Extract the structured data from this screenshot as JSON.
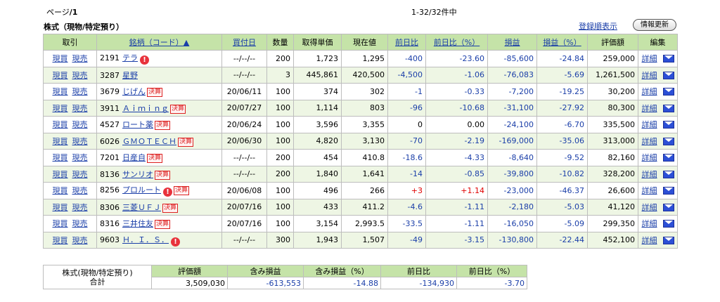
{
  "header": {
    "page_prefix": "ページ",
    "page_num": "/1",
    "count": "1-32/32件中",
    "title": "株式（現物/特定預り）",
    "sort_link": "登録順表示",
    "refresh_label": "情報更新"
  },
  "columns": {
    "trade": "取引",
    "name": "銘柄（コード）▲",
    "buy_date": "買付日",
    "qty": "数量",
    "cost": "取得単価",
    "price": "現在値",
    "change": "前日比",
    "change_pct": "前日比（%）",
    "pl": "損益",
    "pl_pct": "損益（%）",
    "value": "評価額",
    "edit": "編集"
  },
  "labels": {
    "buy": "現買",
    "sell": "現売",
    "detail": "詳細",
    "alert_icon": "!",
    "kessan": "決算"
  },
  "rows": [
    {
      "code": "2191",
      "name": "テラ",
      "alert": true,
      "kessan": false,
      "date": "--/--/--",
      "qty": "200",
      "cost": "1,723",
      "price": "1,295",
      "chg": "-400",
      "chg_pct": "-23.60",
      "pl": "-85,600",
      "pl_pct": "-24.84",
      "value": "259,000"
    },
    {
      "code": "3287",
      "name": "星野",
      "alert": false,
      "kessan": false,
      "date": "--/--/--",
      "qty": "3",
      "cost": "445,861",
      "price": "420,500",
      "chg": "-4,500",
      "chg_pct": "-1.06",
      "pl": "-76,083",
      "pl_pct": "-5.69",
      "value": "1,261,500"
    },
    {
      "code": "3679",
      "name": "じげん",
      "alert": false,
      "kessan": true,
      "date": "20/06/11",
      "qty": "100",
      "cost": "374",
      "price": "302",
      "chg": "-1",
      "chg_pct": "-0.33",
      "pl": "-7,200",
      "pl_pct": "-19.25",
      "value": "30,200"
    },
    {
      "code": "3911",
      "name": "Ａｉｍｉｎｇ",
      "alert": false,
      "kessan": true,
      "date": "20/07/27",
      "qty": "100",
      "cost": "1,114",
      "price": "803",
      "chg": "-96",
      "chg_pct": "-10.68",
      "pl": "-31,100",
      "pl_pct": "-27.92",
      "value": "80,300"
    },
    {
      "code": "4527",
      "name": "ロート薬",
      "alert": false,
      "kessan": true,
      "date": "20/06/24",
      "qty": "100",
      "cost": "3,596",
      "price": "3,355",
      "chg": "0",
      "chg_pct": "0.00",
      "pl": "-24,100",
      "pl_pct": "-6.70",
      "value": "335,500"
    },
    {
      "code": "6026",
      "name": "ＧＭＯＴＥＣＨ",
      "alert": false,
      "kessan": true,
      "date": "20/06/30",
      "qty": "100",
      "cost": "4,820",
      "price": "3,130",
      "chg": "-70",
      "chg_pct": "-2.19",
      "pl": "-169,000",
      "pl_pct": "-35.06",
      "value": "313,000"
    },
    {
      "code": "7201",
      "name": "日産自",
      "alert": false,
      "kessan": true,
      "date": "--/--/--",
      "qty": "200",
      "cost": "454",
      "price": "410.8",
      "chg": "-18.6",
      "chg_pct": "-4.33",
      "pl": "-8,640",
      "pl_pct": "-9.52",
      "value": "82,160"
    },
    {
      "code": "8136",
      "name": "サンリオ",
      "alert": false,
      "kessan": true,
      "date": "--/--/--",
      "qty": "200",
      "cost": "1,840",
      "price": "1,641",
      "chg": "-14",
      "chg_pct": "-0.85",
      "pl": "-39,800",
      "pl_pct": "-10.82",
      "value": "328,200"
    },
    {
      "code": "8256",
      "name": "プロルート",
      "alert": true,
      "kessan": true,
      "date": "20/06/08",
      "qty": "100",
      "cost": "496",
      "price": "266",
      "chg": "+3",
      "chg_pct": "+1.14",
      "pl": "-23,000",
      "pl_pct": "-46.37",
      "value": "26,600"
    },
    {
      "code": "8306",
      "name": "三菱ＵＦＪ",
      "alert": false,
      "kessan": true,
      "date": "20/07/16",
      "qty": "100",
      "cost": "433",
      "price": "411.2",
      "chg": "-4.6",
      "chg_pct": "-1.11",
      "pl": "-2,180",
      "pl_pct": "-5.03",
      "value": "41,120"
    },
    {
      "code": "8316",
      "name": "三井住友",
      "alert": false,
      "kessan": true,
      "date": "20/07/16",
      "qty": "100",
      "cost": "3,154",
      "price": "2,993.5",
      "chg": "-33.5",
      "chg_pct": "-1.11",
      "pl": "-16,050",
      "pl_pct": "-5.09",
      "value": "299,350"
    },
    {
      "code": "9603",
      "name": "Ｈ．Ｉ．Ｓ．",
      "alert": true,
      "kessan": false,
      "date": "--/--/--",
      "qty": "300",
      "cost": "1,943",
      "price": "1,507",
      "chg": "-49",
      "chg_pct": "-3.15",
      "pl": "-130,800",
      "pl_pct": "-22.44",
      "value": "452,100"
    }
  ],
  "summary": {
    "label_line1": "株式(現物/特定預り)",
    "label_line2": "合計",
    "headers": [
      "評価額",
      "含み損益",
      "含み損益（%）",
      "前日比",
      "前日比（%）"
    ],
    "values": [
      "3,509,030",
      "-613,553",
      "-14.88",
      "-134,930",
      "-3.70"
    ],
    "value_colors": [
      "#000000",
      "#1a3ea8",
      "#1a3ea8",
      "#1a3ea8",
      "#1a3ea8"
    ]
  },
  "colors": {
    "header_bg": "#c5e3a8",
    "link": "#1a3ea8",
    "negative": "#1a3ea8",
    "positive": "#e00000",
    "alert": "#e8323c"
  }
}
